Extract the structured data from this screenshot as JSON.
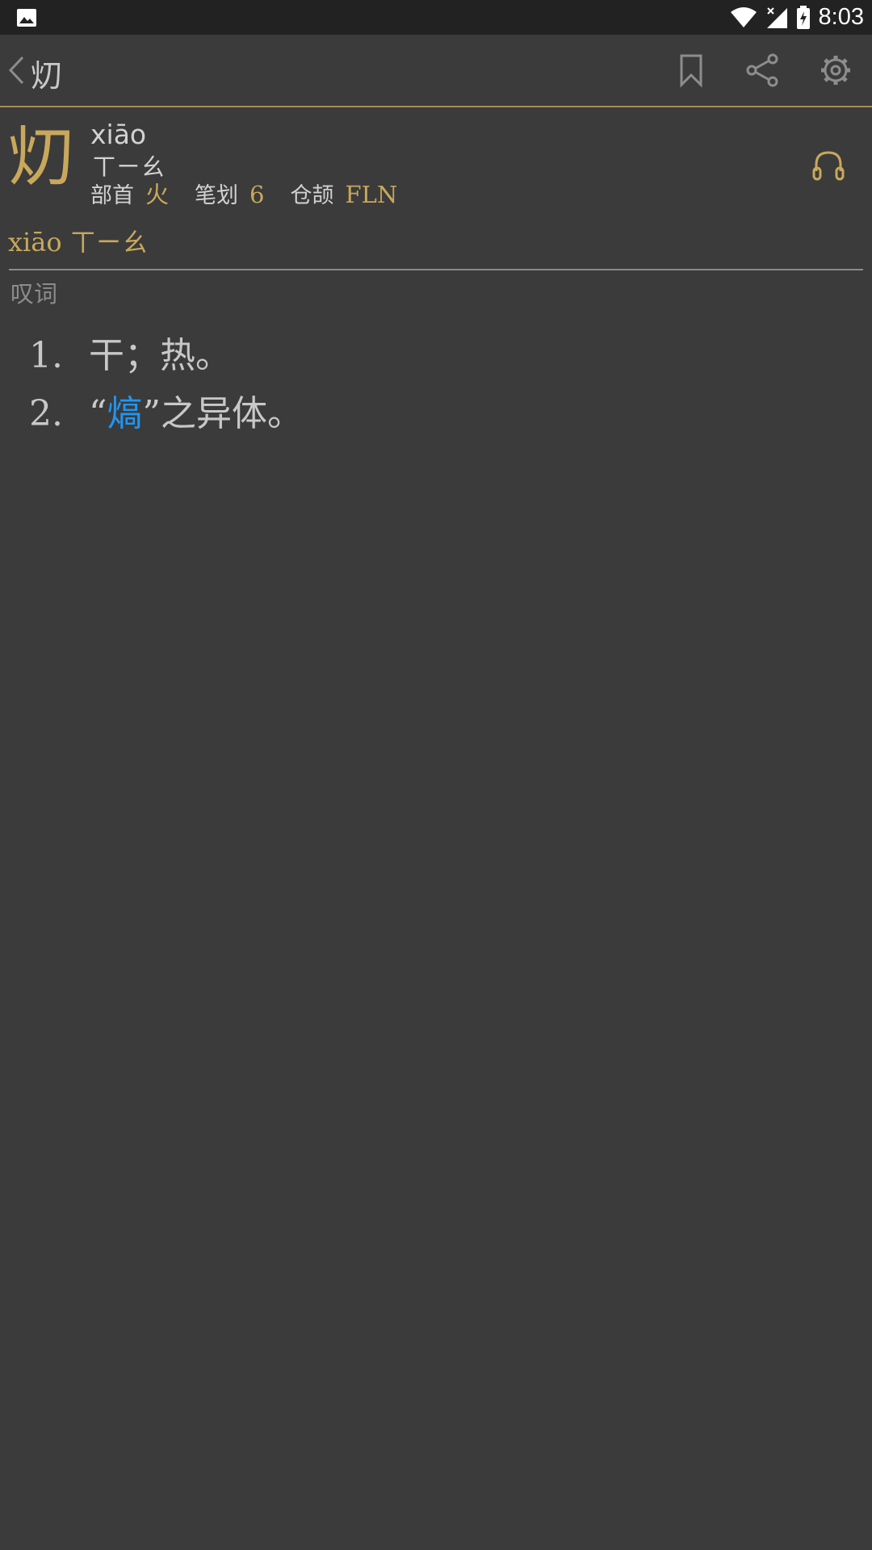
{
  "status_bar": {
    "time": "8:03",
    "icons": [
      "image-icon",
      "wifi-icon",
      "signal-icon",
      "battery-charging-icon"
    ]
  },
  "app_bar": {
    "title": "灱",
    "actions": [
      "bookmark-icon",
      "share-icon",
      "settings-icon"
    ]
  },
  "entry": {
    "character": "灱",
    "pinyin": "xiāo",
    "zhuyin": "ㄒㄧㄠ",
    "radical_label": "部首",
    "radical_value": "火",
    "strokes_label": "笔划",
    "strokes_value": "6",
    "cangjie_label": "仓颉",
    "cangjie_value": "FLN"
  },
  "reading": {
    "pinyin": "xiāo",
    "zhuyin": "ㄒㄧㄠ"
  },
  "part_of_speech": "叹词",
  "definitions": [
    {
      "number": "1.",
      "text": "干；热。"
    },
    {
      "number": "2.",
      "open_quote": "“",
      "link": "熇",
      "close_quote": "”",
      "rest": "之异体。"
    }
  ],
  "colors": {
    "background": "#3b3b3b",
    "accent_gold": "#c9a85b",
    "link_blue": "#2196f3"
  }
}
